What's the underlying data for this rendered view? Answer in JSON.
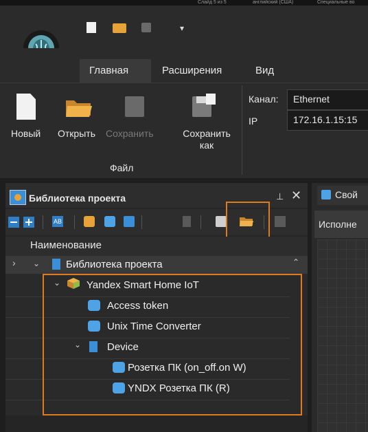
{
  "system_bar": {
    "slide": "Слайд 5 из 5",
    "language": "английский (США)",
    "features": "Специальные во"
  },
  "ribbon": {
    "tabs": [
      "Главная",
      "Расширения",
      "Вид"
    ],
    "buttons": {
      "new": "Новый",
      "open": "Открыть",
      "save": "Сохранить",
      "save_as_line1": "Сохранить",
      "save_as_line2": "как"
    },
    "group_file": "Файл",
    "channel_label": "Канал:",
    "channel_value": "Ethernet",
    "ip_label": "IP",
    "ip_value": "172.16.1.15:15"
  },
  "panel": {
    "title": "Библиотека проекта",
    "column_header": "Наименование"
  },
  "tree": {
    "root": "Библиотека проекта",
    "yandex": "Yandex Smart Home IoT",
    "access_token": "Access token",
    "unix_time": "Unix Time Converter",
    "device": "Device",
    "socket1": "Розетка ПК (on_off.on W)",
    "socket2": "YNDX Розетка ПК (R)"
  },
  "right_pane": {
    "tab": "Свой",
    "header": "Исполне"
  },
  "colors": {
    "highlight": "#e07a1e",
    "accent_blue": "#3a8fd6"
  }
}
